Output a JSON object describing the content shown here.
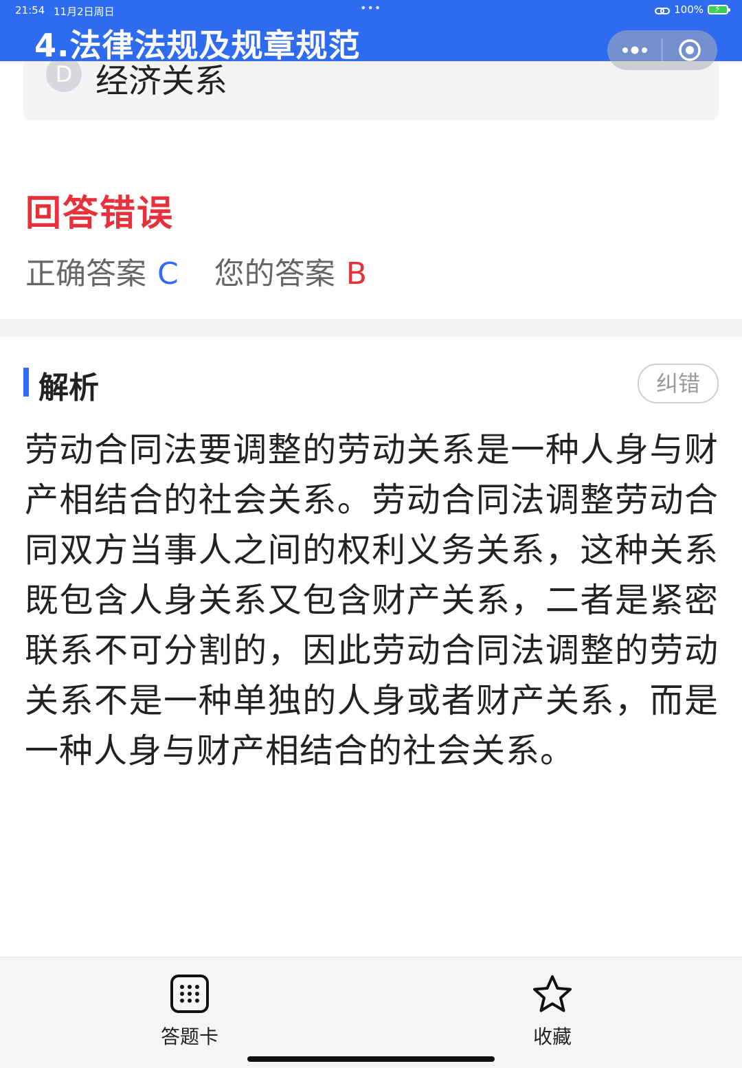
{
  "status_bar": {
    "time": "21:54",
    "date": "11月2日周日",
    "dots": "•••",
    "battery": "100%"
  },
  "header": {
    "title": "4.法律法规及规章规范"
  },
  "option": {
    "letter": "D",
    "text": "经济关系"
  },
  "result": {
    "title": "回答错误",
    "correct_label": "正确答案",
    "correct_value": "C",
    "your_label": "您的答案",
    "your_value": "B"
  },
  "analysis": {
    "title": "解析",
    "report_button": "纠错",
    "text": "劳动合同法要调整的劳动关系是一种人身与财产相结合的社会关系。劳动合同法调整劳动合同双方当事人之间的权利义务关系，这种关系既包含人身关系又包含财产关系，二者是紧密联系不可分割的，因此劳动合同法调整的劳动关系不是一种单独的人身或者财产关系，而是一种人身与财产相结合的社会关系。"
  },
  "bottom_bar": {
    "answer_card_label": "答题卡",
    "favorite_label": "收藏"
  },
  "colors": {
    "accent_blue": "#2f6bf0",
    "error_red": "#e8303a"
  }
}
